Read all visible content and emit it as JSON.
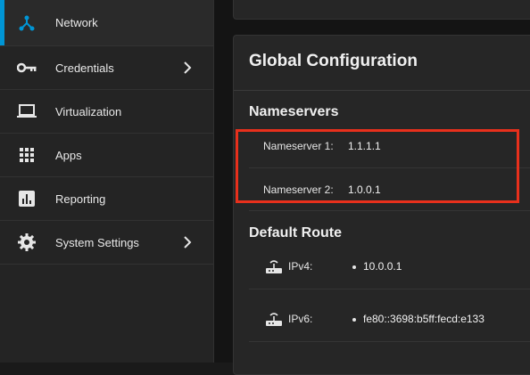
{
  "sidebar": {
    "items": [
      {
        "label": "Network",
        "icon": "network-icon",
        "active": true
      },
      {
        "label": "Credentials",
        "icon": "key-icon",
        "chevron": true
      },
      {
        "label": "Virtualization",
        "icon": "laptop-icon"
      },
      {
        "label": "Apps",
        "icon": "apps-grid-icon"
      },
      {
        "label": "Reporting",
        "icon": "chart-icon"
      },
      {
        "label": "System Settings",
        "icon": "gear-icon",
        "chevron": true
      }
    ]
  },
  "global_config": {
    "title": "Global Configuration",
    "nameservers": {
      "title": "Nameservers",
      "items": [
        {
          "label": "Nameserver 1:",
          "value": "1.1.1.1"
        },
        {
          "label": "Nameserver 2:",
          "value": "1.0.0.1"
        }
      ]
    },
    "default_route": {
      "title": "Default Route",
      "items": [
        {
          "label": "IPv4:",
          "value": "10.0.0.1",
          "icon": "router-icon"
        },
        {
          "label": "IPv6:",
          "value": "fe80::3698:b5ff:fecd:e133",
          "icon": "router-icon"
        }
      ]
    }
  },
  "colors": {
    "accent": "#0095d5",
    "highlight": "#e8301c"
  }
}
